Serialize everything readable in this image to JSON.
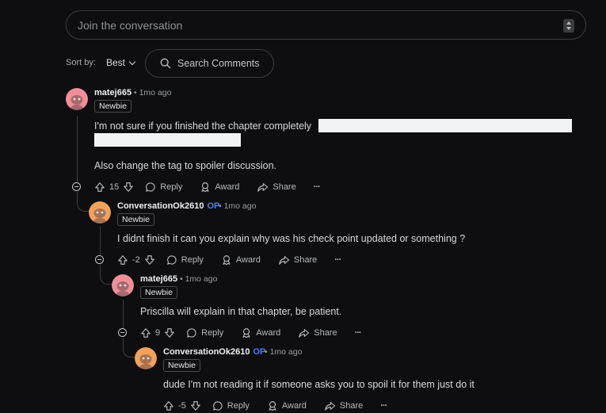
{
  "composer": {
    "placeholder": "Join the conversation"
  },
  "sort": {
    "label": "Sort by:",
    "value": "Best"
  },
  "search": {
    "label": "Search Comments"
  },
  "actions": {
    "reply": "Reply",
    "award": "Award",
    "share": "Share",
    "more": "···"
  },
  "comments": [
    {
      "user": "matej665",
      "op": "",
      "time": "1mo ago",
      "flair": "Newbie",
      "text": "I'm not sure if you finished the chapter completely",
      "text2": "Also change the tag to spoiler discussion.",
      "score": "15",
      "avatar_color": "#f08f9a"
    },
    {
      "user": "ConversationOk2610",
      "op": "OP",
      "time": "1mo ago",
      "flair": "Newbie",
      "text": "I didnt finish it can you explain why was his check point updated or something ?",
      "score": "-2",
      "avatar_color": "#f0a25c"
    },
    {
      "user": "matej665",
      "op": "",
      "time": "1mo ago",
      "flair": "Newbie",
      "text": "Priscilla will explain in that chapter, be patient.",
      "score": "9",
      "avatar_color": "#f08f9a"
    },
    {
      "user": "ConversationOk2610",
      "op": "OP",
      "time": "1mo ago",
      "flair": "Newbie",
      "text": "dude I'm not reading it if someone asks you to spoil it for them just do it",
      "score": "-5",
      "avatar_color": "#f0a25c"
    }
  ]
}
